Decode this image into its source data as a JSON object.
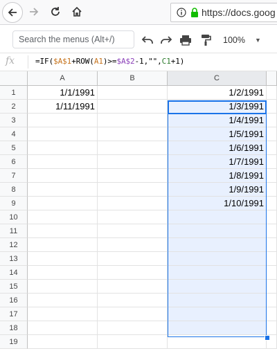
{
  "browser": {
    "url": "https://docs.goog"
  },
  "toolbar": {
    "search_placeholder": "Search the menus (Alt+/)",
    "zoom": "100%"
  },
  "formula_bar": {
    "fx": "fx",
    "formula_parts": [
      "=IF(",
      "$A$1",
      "+ROW(",
      "A1",
      ")>=",
      "$A$2",
      "-1,\"\",",
      "C1",
      "+1)"
    ]
  },
  "columns": [
    "A",
    "B",
    "C"
  ],
  "rows": [
    "1",
    "2",
    "3",
    "4",
    "5",
    "6",
    "7",
    "8",
    "9",
    "10",
    "11",
    "12",
    "13",
    "14",
    "15",
    "16",
    "17",
    "18",
    "19"
  ],
  "cells": {
    "A": [
      "1/1/1991",
      "1/11/1991"
    ],
    "C": [
      "1/2/1991",
      "1/3/1991",
      "1/4/1991",
      "1/5/1991",
      "1/6/1991",
      "1/7/1991",
      "1/8/1991",
      "1/9/1991",
      "1/10/1991"
    ]
  },
  "colors": {
    "selection": "#1a73e8",
    "selection_fill": "#e8f0fe"
  }
}
